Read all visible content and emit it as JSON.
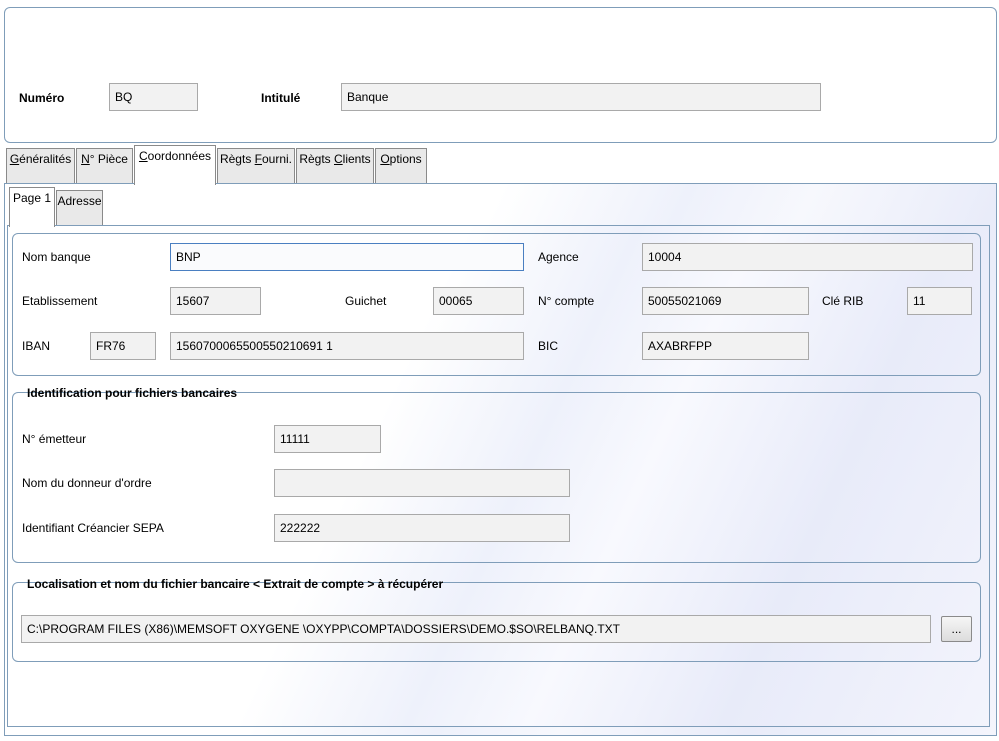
{
  "header": {
    "numero_label": "Numéro",
    "numero_value": "BQ",
    "intitule_label": "Intitulé",
    "intitule_value": "Banque"
  },
  "tabs": [
    {
      "label": "Généralités",
      "accel": "G",
      "rest": "énéralités"
    },
    {
      "label": "N° Pièce",
      "accel": "N",
      "rest": "° Pièce"
    },
    {
      "label": "Coordonnées",
      "accel": "C",
      "rest": "oordonnées"
    },
    {
      "label": "Règts Fourni.",
      "pre": "Règts ",
      "accel": "F",
      "rest": "ourni."
    },
    {
      "label": "Règts Clients",
      "pre": "Règts ",
      "accel": "C",
      "rest": "lients"
    },
    {
      "label": "Options",
      "accel": "O",
      "rest": "ptions"
    }
  ],
  "subtabs": [
    {
      "label": "Page 1"
    },
    {
      "label": "Adresse"
    }
  ],
  "coordonnees": {
    "nom_banque_label": "Nom banque",
    "nom_banque_value": "BNP",
    "agence_label": "Agence",
    "agence_value": "10004",
    "etablissement_label": "Etablissement",
    "etablissement_value": "15607",
    "guichet_label": "Guichet",
    "guichet_value": "00065",
    "ncompte_label": "N° compte",
    "ncompte_value": "50055021069",
    "cle_rib_label": "Clé RIB",
    "cle_rib_value": "11",
    "iban_label": "IBAN",
    "iban_prefix": "FR76",
    "iban_value": "1560700065500550210691 1",
    "bic_label": "BIC",
    "bic_value": "AXABRFPP"
  },
  "identification": {
    "title": "Identification pour fichiers bancaires",
    "emetteur_label": "N° émetteur",
    "emetteur_value": "11111",
    "donneur_label": "Nom du donneur d'ordre",
    "donneur_value": "",
    "sepa_label": "Identifiant Créancier SEPA",
    "sepa_value": "222222"
  },
  "localisation": {
    "title": "Localisation et nom du fichier bancaire < Extrait de compte > à récupérer",
    "path_value": "C:\\PROGRAM FILES (X86)\\MEMSOFT OXYGENE \\OXYPP\\COMPTA\\DOSSIERS\\DEMO.$SO\\RELBANQ.TXT",
    "browse_label": "..."
  }
}
